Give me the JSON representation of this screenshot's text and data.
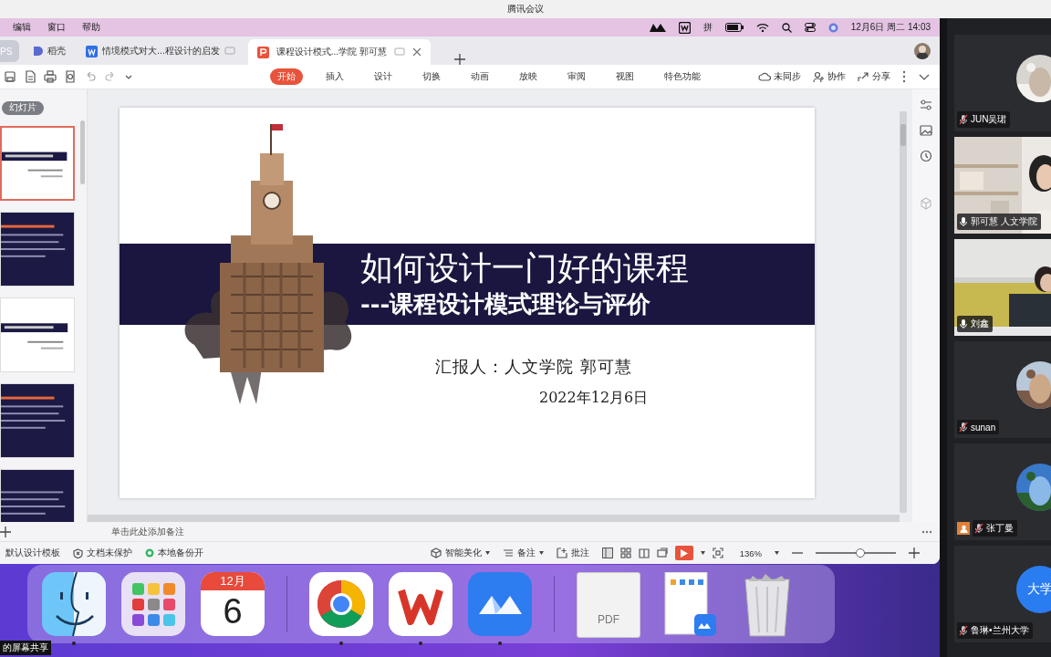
{
  "meeting_title": "腾讯会议",
  "menubar": {
    "items": [
      "编辑",
      "窗口",
      "帮助"
    ],
    "input_method": "拼",
    "clock": "12月6日 周二 14:03"
  },
  "tabs": [
    {
      "label": "PS",
      "kind": "brand",
      "selected": false
    },
    {
      "label": "稻壳",
      "kind": "docer",
      "selected": false
    },
    {
      "label": "情境模式对大...程设计的启发",
      "kind": "doc",
      "selected": false
    },
    {
      "label": "课程设计模式...学院 郭可慧",
      "kind": "ppt",
      "selected": true
    }
  ],
  "ribbon": {
    "tabs": [
      {
        "label": "开始",
        "selected": true
      },
      {
        "label": "插入",
        "selected": false
      },
      {
        "label": "设计",
        "selected": false
      },
      {
        "label": "切换",
        "selected": false
      },
      {
        "label": "动画",
        "selected": false
      },
      {
        "label": "放映",
        "selected": false
      },
      {
        "label": "审阅",
        "selected": false
      },
      {
        "label": "视图",
        "selected": false
      },
      {
        "label": "特色功能",
        "selected": false
      }
    ],
    "actions": [
      {
        "kind": "sync",
        "label": "未同步"
      },
      {
        "kind": "collab",
        "label": "协作"
      },
      {
        "kind": "share",
        "label": "分享"
      }
    ]
  },
  "slides_panel": {
    "title": "幻灯片",
    "thumbnails": [
      {
        "kind": "light",
        "selected": true
      },
      {
        "kind": "dark",
        "selected": false
      },
      {
        "kind": "light",
        "selected": false
      },
      {
        "kind": "dark",
        "selected": false
      },
      {
        "kind": "dark",
        "selected": false
      }
    ]
  },
  "slide": {
    "title": "如何设计一门好的课程",
    "subtitle": "---课程设计模式理论与评价",
    "reporter": "汇报人：人文学院 郭可慧",
    "date": "2022年12月6日"
  },
  "notes_placeholder": "单击此处添加备注",
  "status_bar": {
    "left": [
      {
        "kind": "template",
        "label": "默认设计模板"
      },
      {
        "kind": "protect",
        "label": "文档未保护"
      },
      {
        "kind": "backup",
        "label": "本地备份开"
      }
    ],
    "tools": [
      {
        "kind": "beautify",
        "label": "智能美化"
      },
      {
        "kind": "notes",
        "label": "备注"
      },
      {
        "kind": "comment",
        "label": "批注"
      }
    ],
    "zoom": "136%",
    "zoom_slider": {
      "level": 0.56
    }
  },
  "dock": {
    "apps": [
      {
        "kind": "finder",
        "running": true
      },
      {
        "kind": "launchpad",
        "running": false
      },
      {
        "kind": "calendar",
        "running": false,
        "month": "12月",
        "day": "6"
      },
      {
        "kind": "chrome",
        "running": true
      },
      {
        "kind": "wps",
        "running": true
      },
      {
        "kind": "meeting",
        "running": true
      },
      {
        "kind": "pdf",
        "running": false,
        "label": "PDF"
      },
      {
        "kind": "document",
        "running": false
      },
      {
        "kind": "trash",
        "running": false
      }
    ]
  },
  "screen_share_label": "的屏幕共享",
  "participants": [
    {
      "name": "JUN吴珺",
      "kind": "avatar",
      "muted": true,
      "role_badge": false
    },
    {
      "name": "郭可慧 人文学院",
      "kind": "video",
      "muted": false,
      "role_badge": false
    },
    {
      "name": "刘鑫",
      "kind": "video",
      "muted": false,
      "role_badge": false
    },
    {
      "name": "sunan",
      "kind": "avatar",
      "muted": true,
      "role_badge": false
    },
    {
      "name": "张丁曼",
      "kind": "avatar",
      "muted": true,
      "role_badge": true
    },
    {
      "name": "鲁琳•兰州大学",
      "kind": "text_avatar",
      "avatar_text": "大学",
      "muted": true,
      "role_badge": false
    }
  ]
}
